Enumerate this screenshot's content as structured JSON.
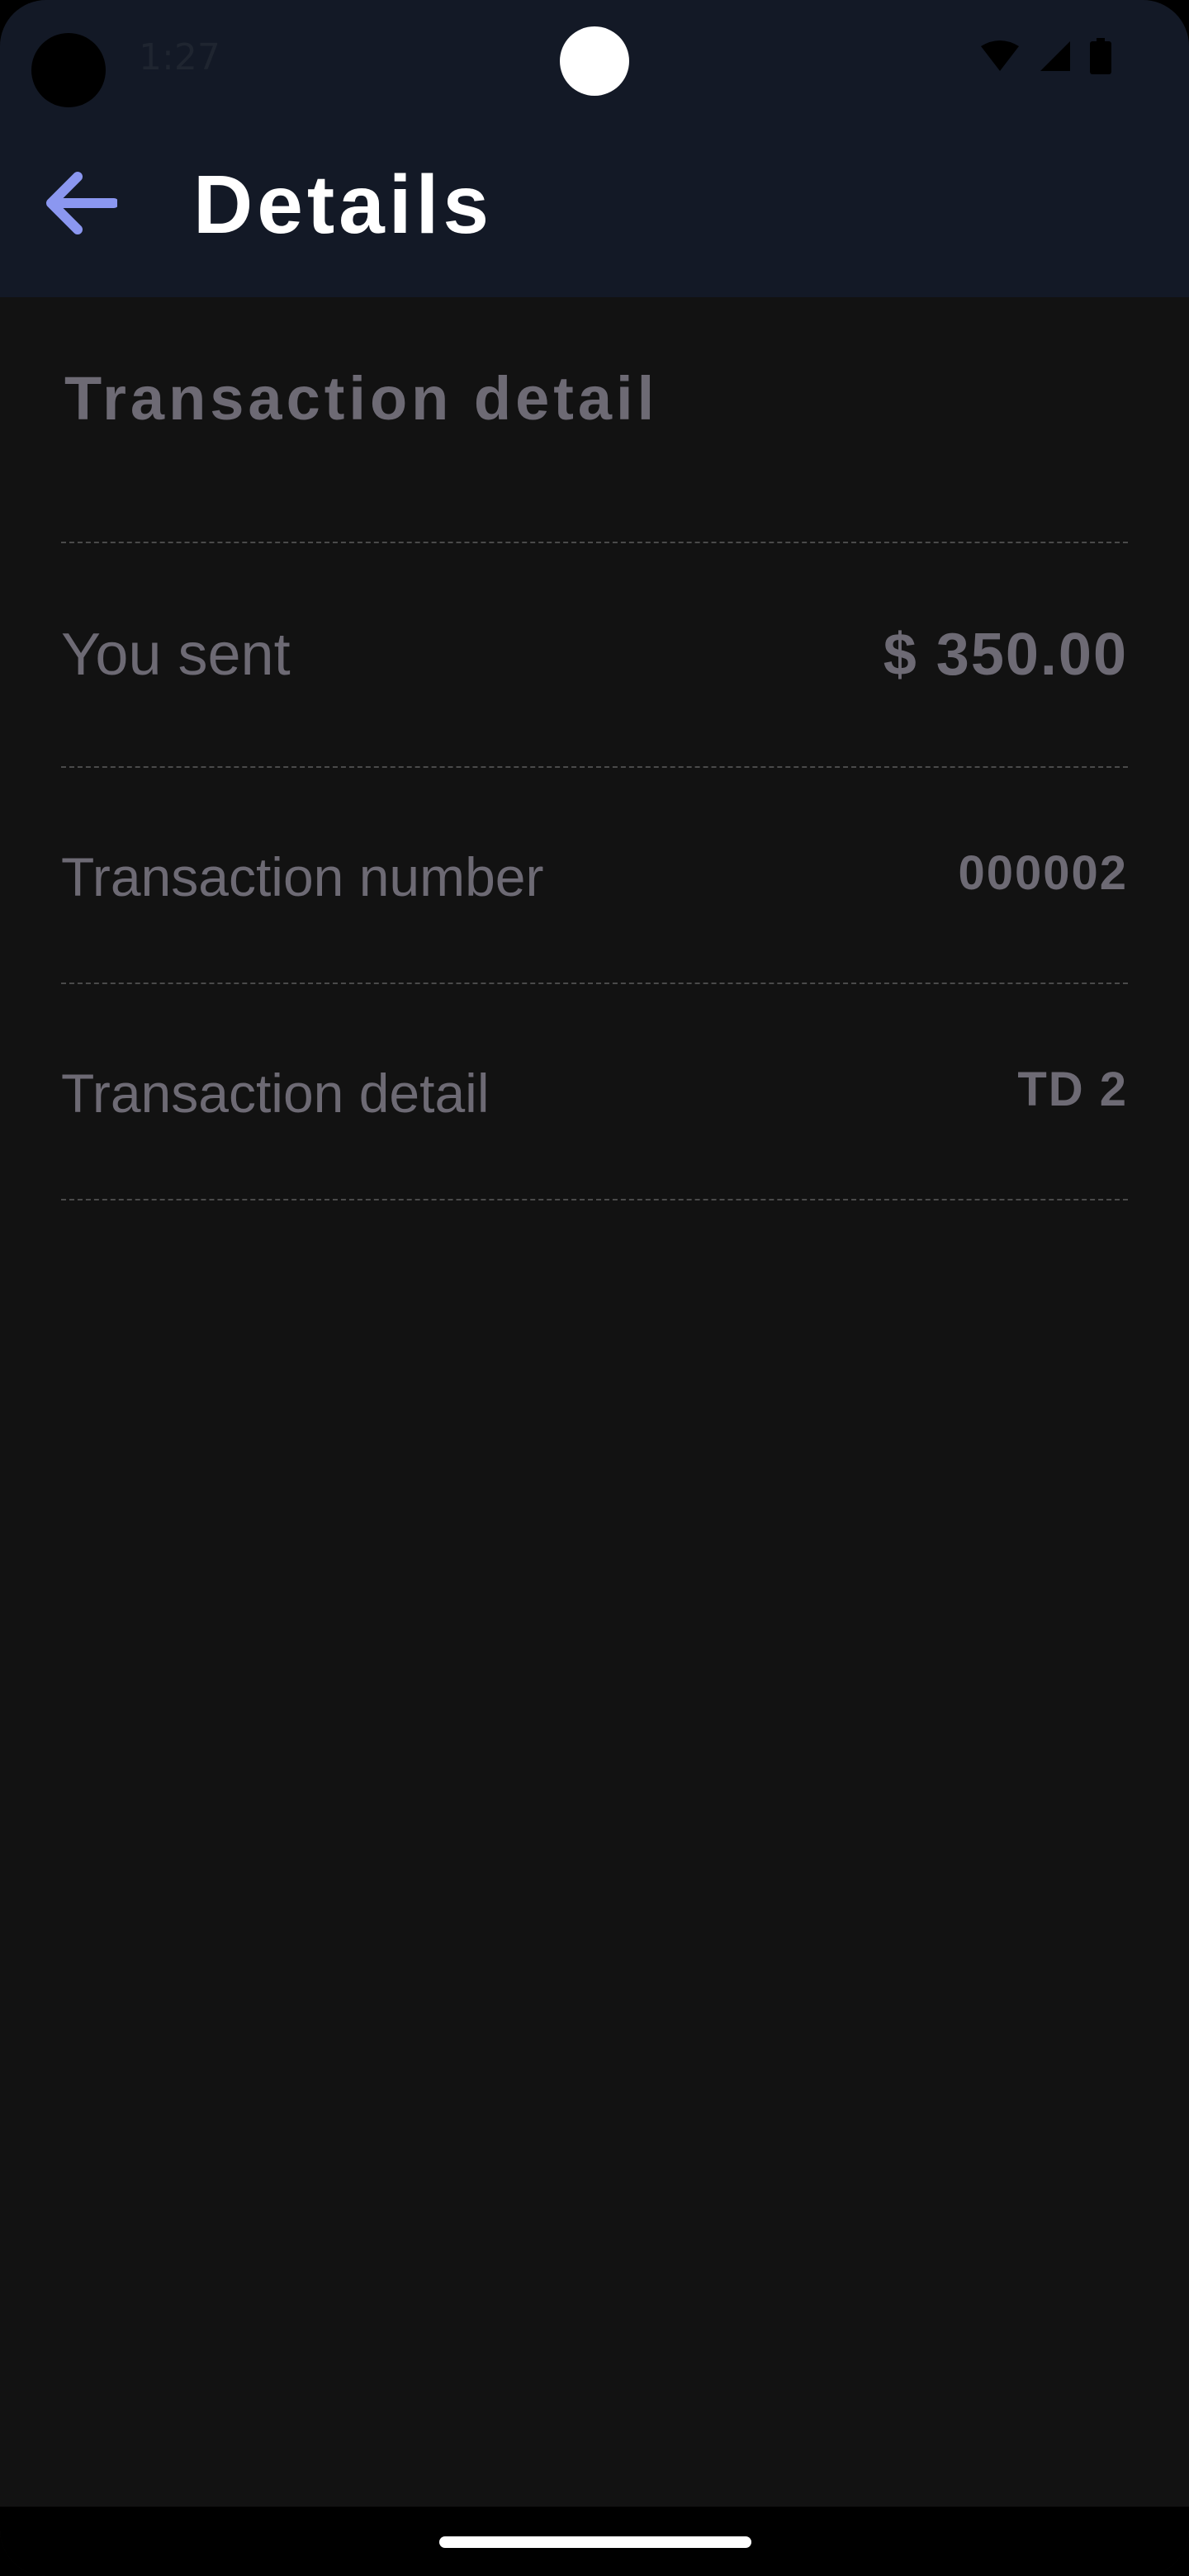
{
  "status_bar": {
    "time": "1:27",
    "icons": [
      "wifi-icon",
      "cellular-signal-icon",
      "battery-icon"
    ]
  },
  "app_bar": {
    "title": "Details",
    "back_icon": "arrow-left-icon",
    "accent_color": "#8b97f0"
  },
  "transaction": {
    "section_title": "Transaction detail",
    "rows": [
      {
        "label": "You sent",
        "value": "$ 350.00"
      },
      {
        "label": "Transaction number",
        "value": "000002"
      },
      {
        "label": "Transaction detail",
        "value": "TD 2"
      }
    ]
  },
  "colors": {
    "app_bar_background": "#131926",
    "page_background": "#121212",
    "muted_text": "#6d6a74",
    "title_text": "#ffffff"
  }
}
